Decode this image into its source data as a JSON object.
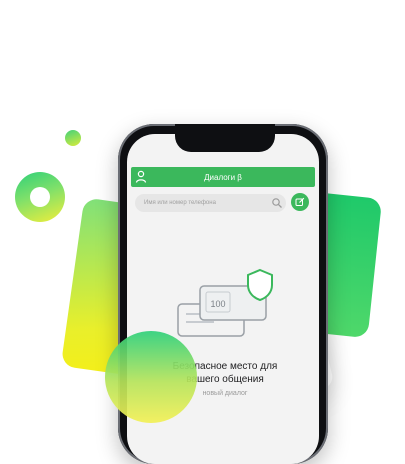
{
  "app": {
    "title": "Диалоги β"
  },
  "search": {
    "placeholder": "Имя или номер телефона"
  },
  "empty_state": {
    "amount": "100",
    "title_line1": "Безопасное место для",
    "title_line2": "вашего общения",
    "subtitle": "новый диалог"
  },
  "colors": {
    "accent": "#3bb85c",
    "background": "#f3f3f3",
    "text": "#1d1d1f",
    "muted": "#9a9a9a"
  },
  "icons": {
    "profile": "person-icon",
    "search": "search-icon",
    "compose": "compose-icon",
    "shield": "shield-icon"
  }
}
